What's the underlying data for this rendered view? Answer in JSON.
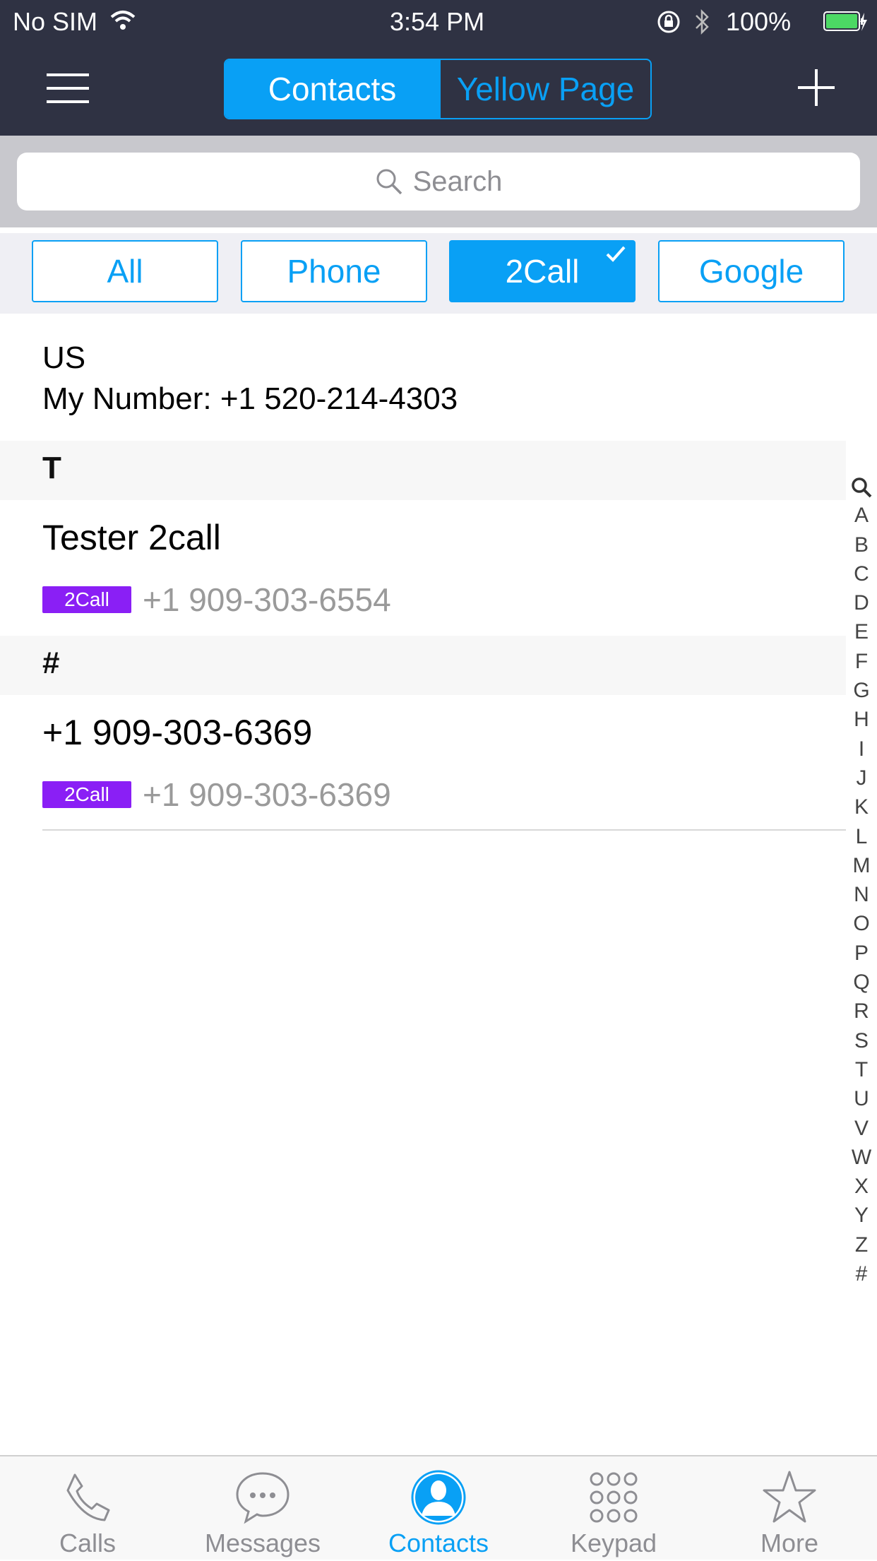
{
  "status_bar": {
    "carrier": "No SIM",
    "time": "3:54 PM",
    "battery": "100%"
  },
  "nav": {
    "segments": [
      "Contacts",
      "Yellow Page"
    ],
    "active_segment": "Contacts"
  },
  "search": {
    "placeholder": "Search"
  },
  "filters": {
    "items": [
      "All",
      "Phone",
      "2Call",
      "Google"
    ],
    "active": "2Call"
  },
  "my_number": {
    "region": "US",
    "text": "My Number: +1 520-214-4303"
  },
  "sections": [
    {
      "letter": "T",
      "contacts": [
        {
          "name": "Tester 2call",
          "badge": "2Call",
          "phone": "+1 909-303-6554"
        }
      ]
    },
    {
      "letter": "#",
      "contacts": [
        {
          "name": "+1 909-303-6369",
          "badge": "2Call",
          "phone": "+1 909-303-6369"
        }
      ]
    }
  ],
  "index_letters": [
    "A",
    "B",
    "C",
    "D",
    "E",
    "F",
    "G",
    "H",
    "I",
    "J",
    "K",
    "L",
    "M",
    "N",
    "O",
    "P",
    "Q",
    "R",
    "S",
    "T",
    "U",
    "V",
    "W",
    "X",
    "Y",
    "Z",
    "#"
  ],
  "tab_bar": {
    "items": [
      "Calls",
      "Messages",
      "Contacts",
      "Keypad",
      "More"
    ],
    "active": "Contacts"
  },
  "colors": {
    "accent": "#09a0f5",
    "header": "#2f3243",
    "badge": "#8a1ff5"
  }
}
